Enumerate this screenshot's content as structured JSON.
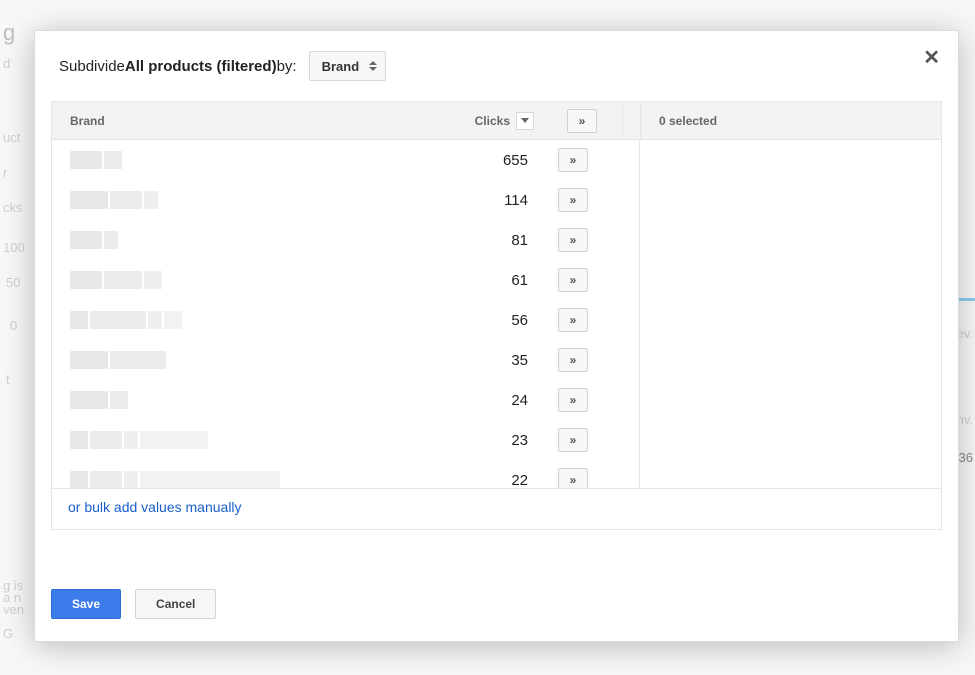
{
  "dialog": {
    "subdivide_prefix": "Subdivide ",
    "subdivide_target": "All products (filtered)",
    "subdivide_suffix": " by:",
    "dropdown_value": "Brand",
    "close_glyph": "✕"
  },
  "headers": {
    "brand": "Brand",
    "clicks": "Clicks",
    "addall_glyph": "»",
    "selected": "0 selected"
  },
  "rows": [
    {
      "clicks": "655",
      "glyph": "»"
    },
    {
      "clicks": "114",
      "glyph": "»"
    },
    {
      "clicks": "81",
      "glyph": "»"
    },
    {
      "clicks": "61",
      "glyph": "»"
    },
    {
      "clicks": "56",
      "glyph": "»"
    },
    {
      "clicks": "35",
      "glyph": "»"
    },
    {
      "clicks": "24",
      "glyph": "»"
    },
    {
      "clicks": "23",
      "glyph": "»"
    },
    {
      "clicks": "22",
      "glyph": "»"
    },
    {
      "clicks": "",
      "glyph": "»"
    },
    {
      "clicks": "",
      "glyph": "»"
    }
  ],
  "footer_link": "or bulk add values manually",
  "buttons": {
    "save": "Save",
    "cancel": "Cancel"
  },
  "bg": {
    "g": "g",
    "d": "d",
    "uct": "uct",
    "r": "r",
    "cks": "cks",
    "n100": "100",
    "n50": "50",
    "zero": "0",
    "t": "t",
    "gis": "g is",
    "an": "a n",
    "ven": "ven",
    "G": "G",
    "ev": "ev.",
    "nv": "nv.",
    "n36": "36"
  }
}
